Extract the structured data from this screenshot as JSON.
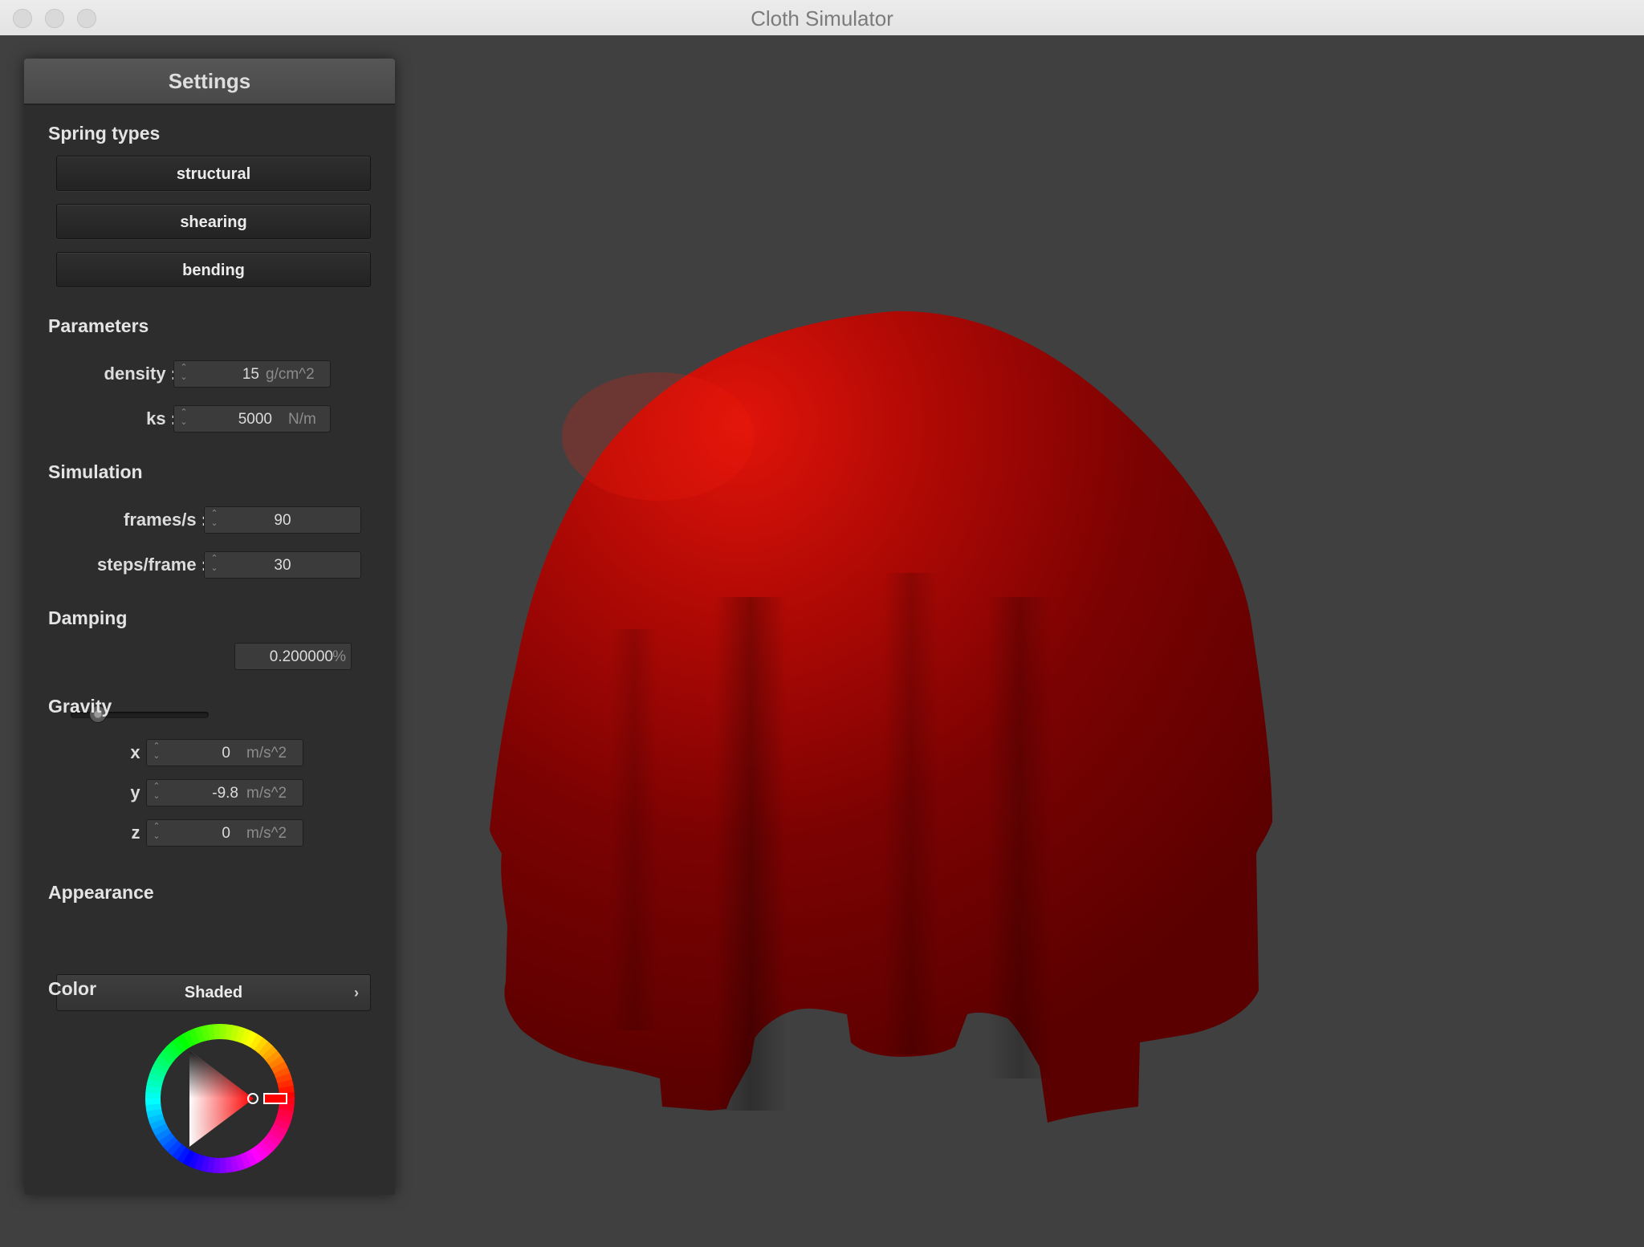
{
  "window": {
    "title": "Cloth Simulator"
  },
  "panel": {
    "title": "Settings",
    "spring_types": {
      "title": "Spring types",
      "buttons": [
        "structural",
        "shearing",
        "bending"
      ]
    },
    "parameters": {
      "title": "Parameters",
      "density": {
        "label": "density :",
        "value": "15",
        "unit": "g/cm^2"
      },
      "ks": {
        "label": "ks :",
        "value": "5000",
        "unit": "N/m"
      }
    },
    "simulation": {
      "title": "Simulation",
      "fps": {
        "label": "frames/s :",
        "value": "90"
      },
      "steps": {
        "label": "steps/frame :",
        "value": "30"
      }
    },
    "damping": {
      "title": "Damping",
      "value": "0.200000",
      "unit": "%",
      "slider_fraction": 0.2
    },
    "gravity": {
      "title": "Gravity",
      "x": {
        "label": "x :",
        "value": "0",
        "unit": "m/s^2"
      },
      "y": {
        "label": "y :",
        "value": "-9.8",
        "unit": "m/s^2"
      },
      "z": {
        "label": "z :",
        "value": "0",
        "unit": "m/s^2"
      }
    },
    "appearance": {
      "title": "Appearance",
      "selected": "Shaded"
    },
    "color": {
      "title": "Color",
      "selected_color": "#ff0000"
    }
  },
  "viewport": {
    "background": "#404040",
    "cloth_color": "#b00000"
  }
}
